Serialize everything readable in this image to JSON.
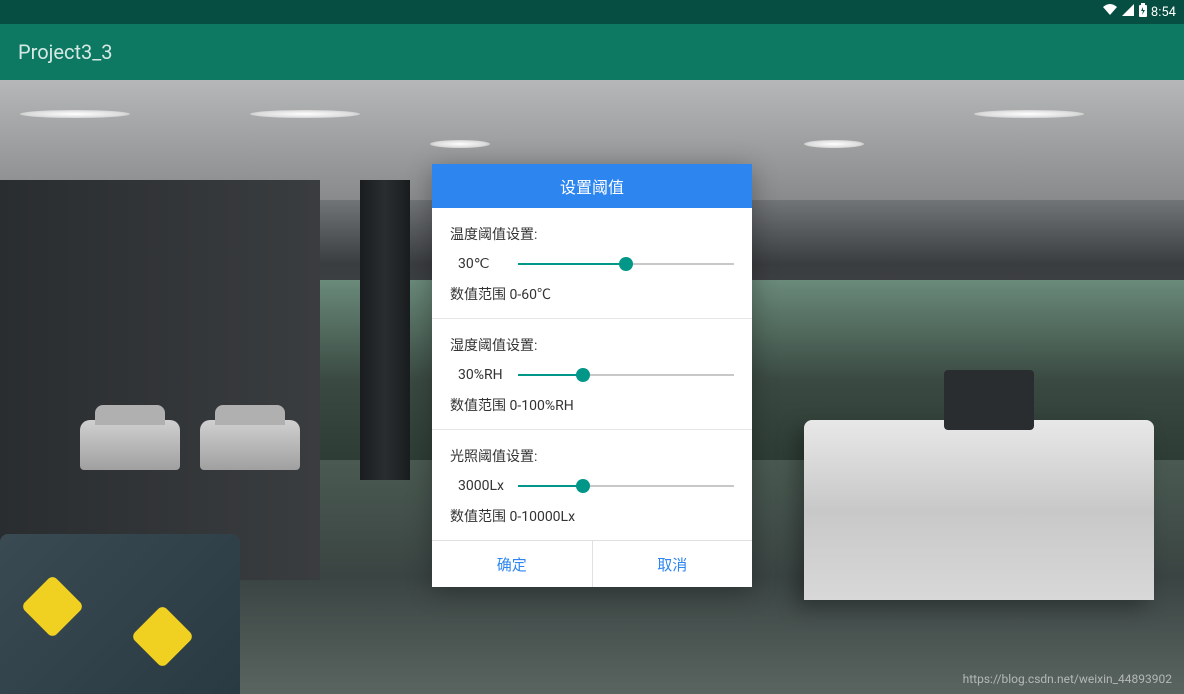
{
  "statusBar": {
    "time": "8:54"
  },
  "appBar": {
    "title": "Project3_3"
  },
  "dialog": {
    "title": "设置阈值",
    "sections": [
      {
        "label": "温度阈值设置:",
        "value": "30℃",
        "range": "数值范围 0-60℃",
        "percent": 50
      },
      {
        "label": "湿度阈值设置:",
        "value": "30%RH",
        "range": "数值范围 0-100%RH",
        "percent": 30
      },
      {
        "label": "光照阈值设置:",
        "value": "3000Lx",
        "range": "数值范围 0-10000Lx",
        "percent": 30
      }
    ],
    "actions": {
      "confirm": "确定",
      "cancel": "取消"
    }
  },
  "watermark": "https://blog.csdn.net/weixin_44893902"
}
